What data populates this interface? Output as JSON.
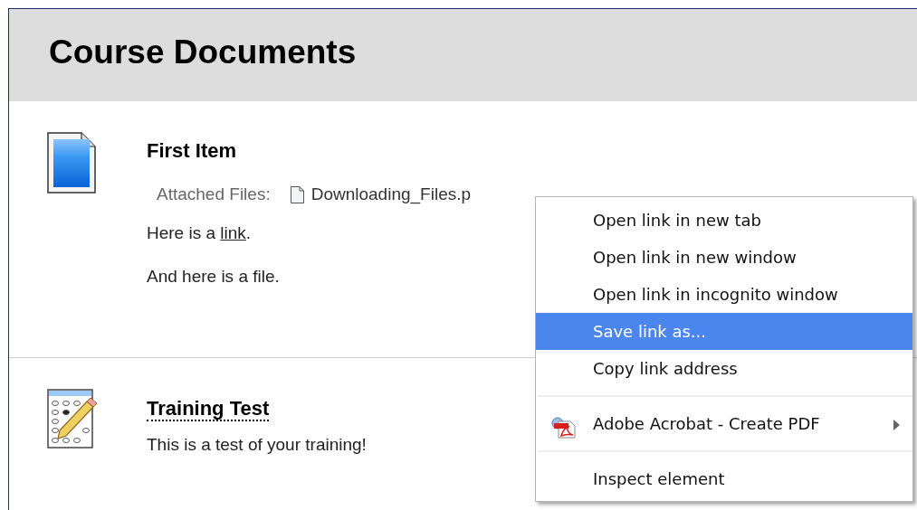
{
  "page": {
    "title": "Course Documents"
  },
  "items": [
    {
      "kind": "document",
      "title": "First Item",
      "attachment": {
        "label": "Attached Files:",
        "file": "Downloading_Files.p"
      },
      "paragraphs": [
        {
          "before": "Here is a ",
          "link": "link",
          "after": "."
        },
        {
          "before": "And here is a file."
        }
      ]
    },
    {
      "kind": "test",
      "title": "Training Test",
      "paragraphs": [
        {
          "before": "This is a test of your training!"
        }
      ]
    }
  ],
  "context_menu": {
    "items": [
      {
        "kind": "item",
        "label": "Open link in new tab",
        "selected": false,
        "submenu": false
      },
      {
        "kind": "item",
        "label": "Open link in new window",
        "selected": false,
        "submenu": false
      },
      {
        "kind": "item",
        "label": "Open link in incognito window",
        "selected": false,
        "submenu": false
      },
      {
        "kind": "item",
        "label": "Save link as...",
        "selected": true,
        "submenu": false
      },
      {
        "kind": "item",
        "label": "Copy link address",
        "selected": false,
        "submenu": false
      },
      {
        "kind": "separator"
      },
      {
        "kind": "app-item",
        "label": "Adobe Acrobat - Create PDF",
        "selected": false,
        "submenu": true
      },
      {
        "kind": "separator"
      },
      {
        "kind": "item",
        "label": "Inspect element",
        "selected": false,
        "submenu": false
      }
    ]
  }
}
